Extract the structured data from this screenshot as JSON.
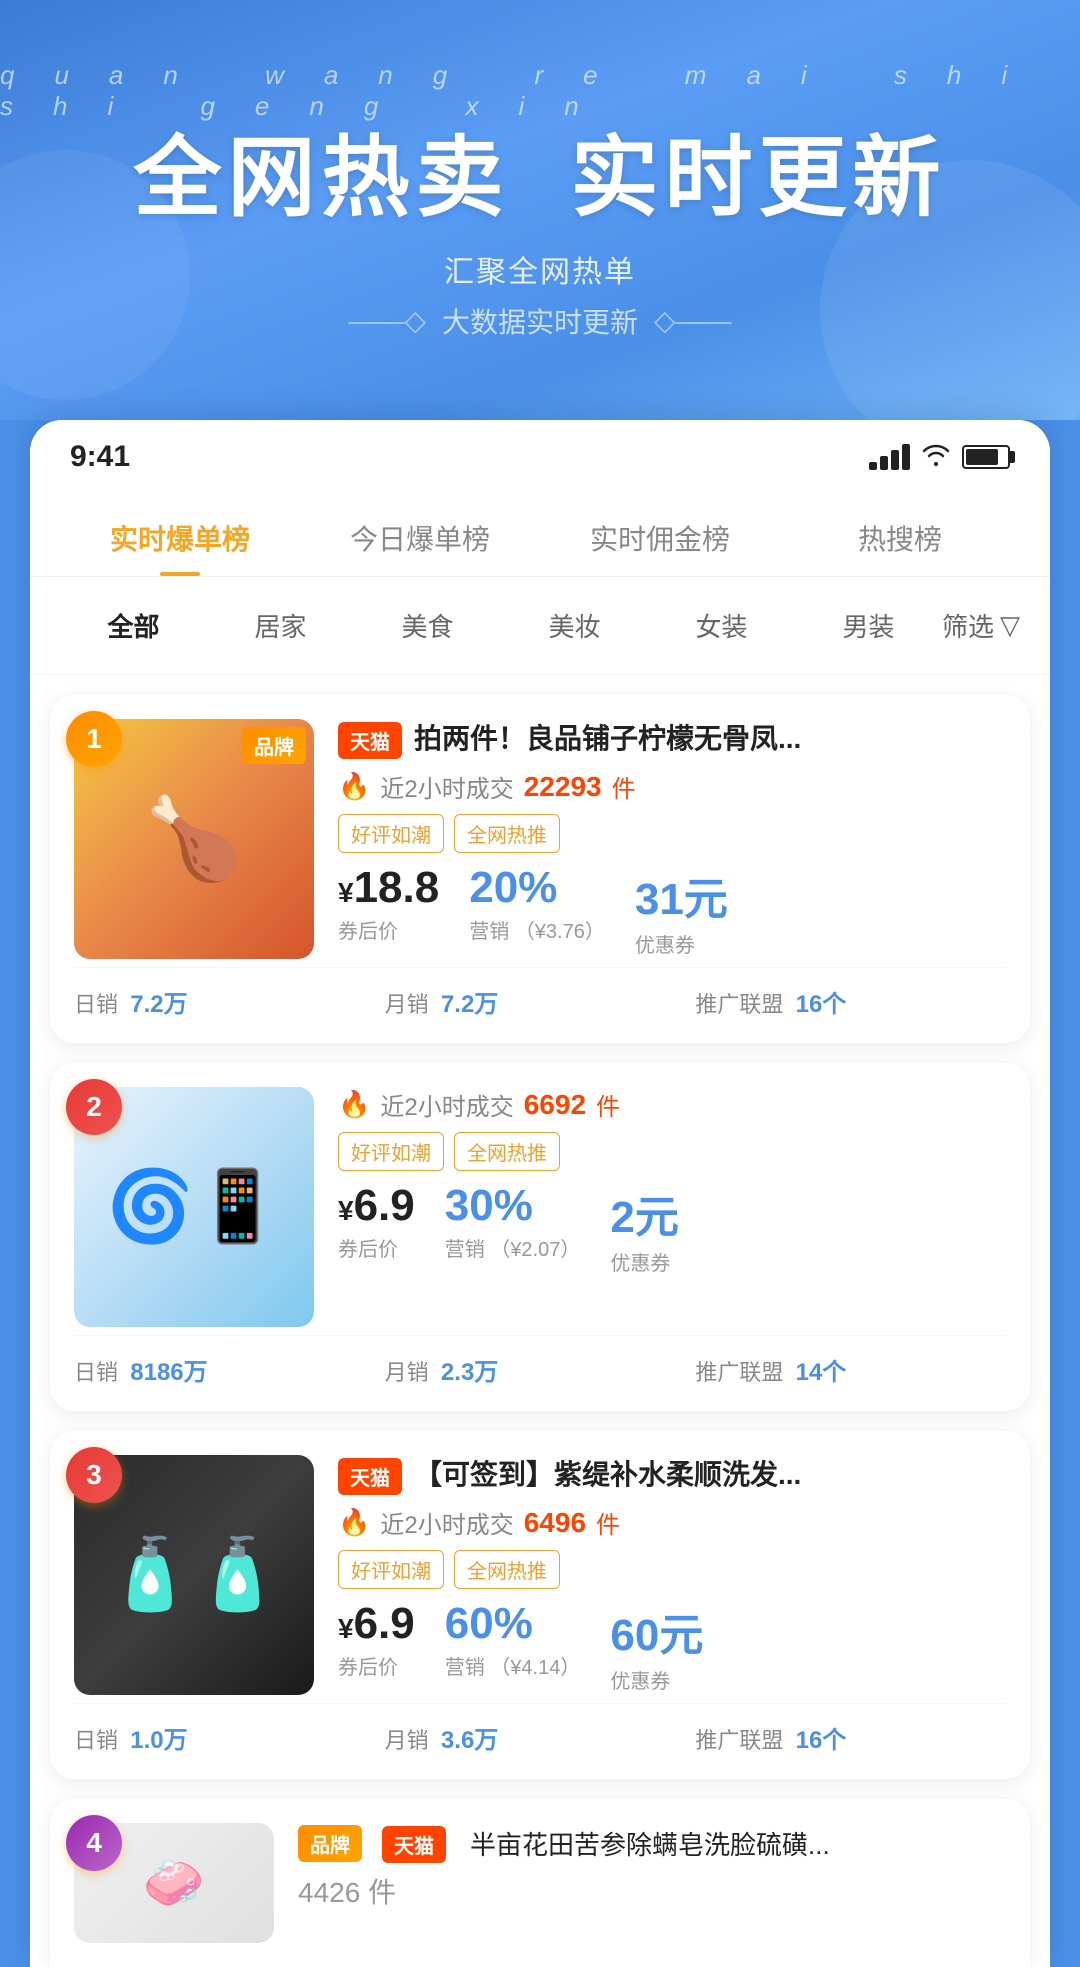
{
  "app": {
    "title": "全网热卖 实时更新"
  },
  "hero": {
    "pinyin": "quan  wang  re  mai      shi  shi  geng  xin",
    "title": "全网热卖 实时更新",
    "subtitle": "汇聚全网热单",
    "divider_text": "大数据实时更新"
  },
  "status_bar": {
    "time": "9:41"
  },
  "tabs": [
    {
      "id": "realtime",
      "label": "实时爆单榜",
      "active": true
    },
    {
      "id": "today",
      "label": "今日爆单榜",
      "active": false
    },
    {
      "id": "commission",
      "label": "实时佣金榜",
      "active": false
    },
    {
      "id": "search",
      "label": "热搜榜",
      "active": false
    }
  ],
  "categories": [
    {
      "id": "all",
      "label": "全部",
      "active": true
    },
    {
      "id": "home",
      "label": "居家",
      "active": false
    },
    {
      "id": "food",
      "label": "美食",
      "active": false
    },
    {
      "id": "beauty",
      "label": "美妆",
      "active": false
    },
    {
      "id": "women",
      "label": "女装",
      "active": false
    },
    {
      "id": "men",
      "label": "男装",
      "active": false
    },
    {
      "id": "filter",
      "label": "筛选",
      "active": false
    }
  ],
  "products": [
    {
      "rank": 1,
      "rank_class": "rank-1",
      "platform": "天猫",
      "platform_class": "tmall",
      "has_brand_tag": true,
      "brand_tag": "品牌",
      "name": "拍两件！良品铺子柠檬无骨凤...",
      "image_type": "food",
      "image_emoji": "🍗",
      "sales_2h_label": "近2小时成交",
      "sales_2h_count": "22293",
      "sales_2h_unit": "件",
      "tags": [
        "好评如潮",
        "全网热推"
      ],
      "price": "18.8",
      "price_label": "券后价",
      "commission_pct": "20%",
      "commission_amount": "¥3.76",
      "commission_label": "营销",
      "coupon": "31元",
      "coupon_label": "优惠券",
      "daily_sales_label": "日销",
      "daily_sales": "7.2万",
      "monthly_sales_label": "月销",
      "monthly_sales": "7.2万",
      "alliance_label": "推广联盟",
      "alliance_count": "16个"
    },
    {
      "rank": 2,
      "rank_class": "rank-2",
      "platform": "",
      "platform_class": "",
      "has_brand_tag": false,
      "brand_tag": "",
      "name": "",
      "image_type": "fan",
      "image_emoji": "🌀",
      "sales_2h_label": "近2小时成交",
      "sales_2h_count": "6692",
      "sales_2h_unit": "件",
      "tags": [
        "好评如潮",
        "全网热推"
      ],
      "price": "6.9",
      "price_label": "券后价",
      "commission_pct": "30%",
      "commission_amount": "¥2.07",
      "commission_label": "营销",
      "coupon": "2元",
      "coupon_label": "优惠券",
      "daily_sales_label": "日销",
      "daily_sales": "8186万",
      "monthly_sales_label": "月销",
      "monthly_sales": "2.3万",
      "alliance_label": "推广联盟",
      "alliance_count": "14个"
    },
    {
      "rank": 3,
      "rank_class": "rank-3",
      "platform": "天猫",
      "platform_class": "tmall",
      "has_brand_tag": false,
      "brand_tag": "",
      "name": "【可签到】紫缇补水柔顺洗发...",
      "image_type": "shampoo",
      "image_emoji": "🧴",
      "sales_2h_label": "近2小时成交",
      "sales_2h_count": "6496",
      "sales_2h_unit": "件",
      "tags": [
        "好评如潮",
        "全网热推"
      ],
      "price": "6.9",
      "price_label": "券后价",
      "commission_pct": "60%",
      "commission_amount": "¥4.14",
      "commission_label": "营销",
      "coupon": "60元",
      "coupon_label": "优惠券",
      "daily_sales_label": "日销",
      "daily_sales": "1.0万",
      "monthly_sales_label": "月销",
      "monthly_sales": "3.6万",
      "alliance_label": "推广联盟",
      "alliance_count": "16个"
    }
  ],
  "partial_product": {
    "rank": 4,
    "rank_class": "rank-4",
    "platform": "天猫",
    "has_brand_tag": true,
    "brand_tag": "品牌",
    "name": "半亩花田苦参除螨皂洗脸硫磺...",
    "image_type": "soap",
    "image_emoji": "🧼",
    "sales_2h_count": "4426",
    "sales_2h_label": "件"
  },
  "icons": {
    "filter": "▽",
    "fire": "🔥",
    "signal": "📶",
    "wifi": "WiFi",
    "battery": "🔋"
  }
}
